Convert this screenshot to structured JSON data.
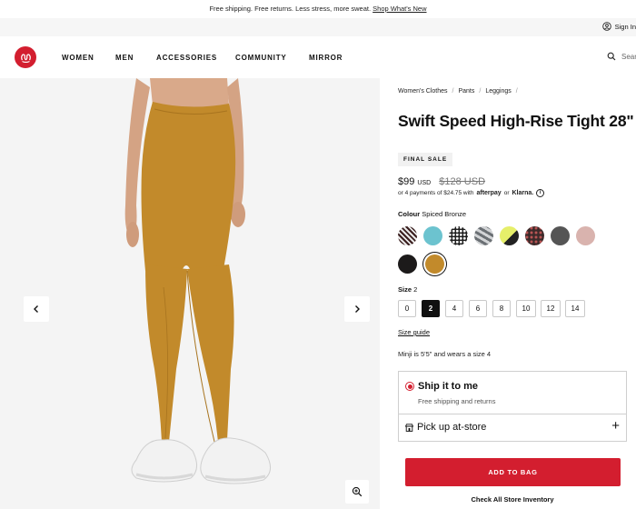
{
  "promo": {
    "text": "Free shipping. Free returns. Less stress, more sweat.",
    "link": "Shop What's New"
  },
  "util": {
    "signin": "Sign In",
    "signin_icon": "user-circle-icon"
  },
  "nav": {
    "logo": "lululemon-logo",
    "items": [
      "WOMEN",
      "MEN",
      "ACCESSORIES",
      "COMMUNITY",
      "MIRROR"
    ],
    "search_placeholder": "Search",
    "search_icon": "search-icon"
  },
  "gallery": {
    "prev_icon": "chevron-left-icon",
    "next_icon": "chevron-right-icon",
    "zoom_icon": "zoom-in-icon"
  },
  "product": {
    "breadcrumbs": [
      "Women's Clothes",
      "Pants",
      "Leggings"
    ],
    "title": "Swift Speed High-Rise Tight 28\"",
    "badge": "FINAL SALE",
    "price": "$99",
    "price_currency": "USD",
    "original_price": "$128 USD",
    "installments_text": "or 4 payments of $24.75 with",
    "afterpay": "afterpay",
    "or_text": "or",
    "klarna": "Klarna.",
    "info_icon": "info-icon",
    "colour_label": "Colour",
    "colour_value": "Spiced Bronze",
    "swatches": [
      {
        "name": "black-white-pattern",
        "color": "#4a2c2c"
      },
      {
        "name": "teal",
        "color": "#6cc3cf"
      },
      {
        "name": "black-dots",
        "color": "#1f1f1f"
      },
      {
        "name": "grey-camo",
        "color": "#9aa0a4"
      },
      {
        "name": "yellow-black",
        "color": "#e6ef6a"
      },
      {
        "name": "dark-speckle",
        "color": "#3a2a2a"
      },
      {
        "name": "charcoal",
        "color": "#555555"
      },
      {
        "name": "pink-mist",
        "color": "#d9b3ae"
      },
      {
        "name": "black",
        "color": "#1c1a1a"
      },
      {
        "name": "spiced-bronze",
        "color": "#c28a2b"
      }
    ],
    "selected_swatch": 9,
    "size_label": "Size",
    "size_value": "2",
    "sizes": [
      "0",
      "2",
      "4",
      "6",
      "8",
      "10",
      "12",
      "14"
    ],
    "selected_size": "2",
    "size_guide": "Size guide",
    "model_text": "Minji is 5'5\" and wears a size 4"
  },
  "fulfillment": {
    "ship_title": "Ship it to me",
    "ship_sub": "Free shipping and returns",
    "pickup_title": "Pick up at-store",
    "pickup_icon": "store-icon",
    "plus_icon": "plus-icon",
    "add_to_bag": "ADD TO BAG",
    "inventory": "Check All Store Inventory"
  },
  "colors": {
    "brand_red": "#d31e2f",
    "legging": "#c28a2b"
  }
}
